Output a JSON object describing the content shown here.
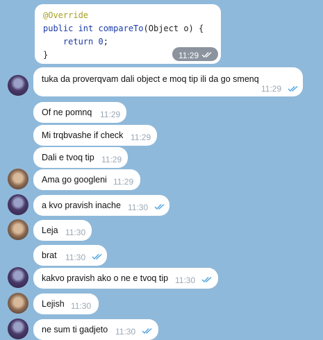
{
  "code_message": {
    "lines": [
      {
        "ann": "@Override"
      },
      {
        "kw": "public int ",
        "fn": "compareTo",
        "rest": "(Object o) {"
      },
      {
        "indent": "    ",
        "kw": "return ",
        "num": "0",
        "rest": ";"
      },
      {
        "rest": "}"
      }
    ],
    "time": "11:29"
  },
  "messages": [
    {
      "text": "tuka da proverqvam dali object e moq tip ili da go smenq",
      "time": "11:29",
      "avatar": "user-a"
    },
    {
      "text": "Of ne pomnq",
      "time": "11:29"
    },
    {
      "text": "Mi trqbvashe if check",
      "time": "11:29"
    },
    {
      "text": "Dali e tvoq tip",
      "time": "11:29"
    },
    {
      "text": "Ama go googleni",
      "time": "11:29",
      "avatar": "user-b"
    },
    {
      "text": "a kvo pravish inache",
      "time": "11:30",
      "avatar": "user-a"
    },
    {
      "text": "Leja",
      "time": "11:30",
      "avatar": "user-b"
    },
    {
      "text": "brat",
      "time": "11:30"
    },
    {
      "text": "kakvo pravish ako o ne e tvoq tip",
      "time": "11:30",
      "avatar": "user-a"
    },
    {
      "text": "Lejish",
      "time": "11:30",
      "avatar": "user-b"
    },
    {
      "text": "ne sum ti gadjeto",
      "time": "11:30",
      "avatar": "user-a"
    }
  ],
  "colors": {
    "background": "#8fb9da",
    "bubble": "#ffffff",
    "check": "#4fa3e0"
  }
}
